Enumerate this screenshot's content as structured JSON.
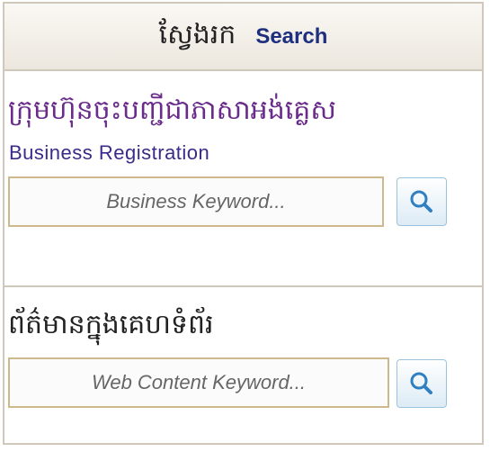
{
  "header": {
    "title_kh": "ស្វែងរក",
    "title_en": "Search"
  },
  "business": {
    "title_kh": "ក្រុមហ៊ុនចុះបញ្ជីជាភាសាអង់គ្លេស",
    "title_en": "Business Registration",
    "placeholder": "Business Keyword...",
    "search_icon": "magnifier-icon"
  },
  "web": {
    "title_kh": "ព័ត៌មានក្នុងគេហទំព័រ",
    "placeholder": "Web Content Keyword...",
    "search_icon": "magnifier-icon"
  },
  "colors": {
    "border": "#cfc8bb",
    "field_border": "#cdb98c",
    "accent_title": "#1f2f80",
    "business_title": "#6a2c8a",
    "icon_blue": "#2f7fc1"
  }
}
